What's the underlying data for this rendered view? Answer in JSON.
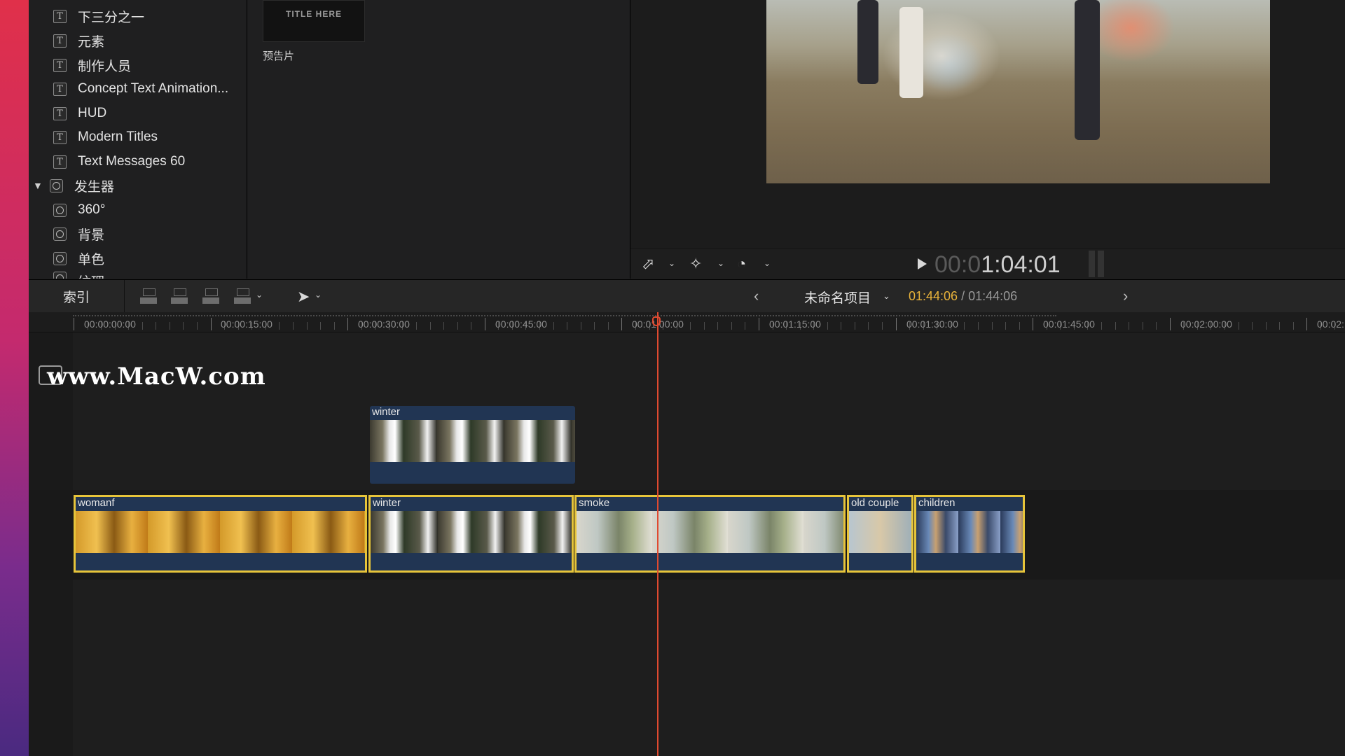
{
  "sidebar": {
    "items": [
      {
        "label": "下三分之一",
        "icon": "title-icon"
      },
      {
        "label": "元素",
        "icon": "title-icon"
      },
      {
        "label": "制作人员",
        "icon": "title-icon"
      },
      {
        "label": "Concept Text Animation...",
        "icon": "title-icon"
      },
      {
        "label": "HUD",
        "icon": "title-icon"
      },
      {
        "label": "Modern Titles",
        "icon": "title-icon"
      },
      {
        "label": "Text Messages 60",
        "icon": "title-icon"
      }
    ],
    "generators_label": "发生器",
    "generator_items": [
      {
        "label": "360°",
        "icon": "generator-icon"
      },
      {
        "label": "背景",
        "icon": "generator-icon"
      },
      {
        "label": "单色",
        "icon": "generator-icon"
      },
      {
        "label": "纹理",
        "icon": "generator-icon"
      }
    ]
  },
  "browser": {
    "thumbnail_text": "TITLE HERE",
    "thumbnail_label": "预告片"
  },
  "viewer": {
    "timecode_dim": "00:0",
    "timecode_main": "1:04:01"
  },
  "toolbar": {
    "index_label": "索引",
    "project_name": "未命名项目",
    "current_duration": "01:44:06",
    "separator": "/",
    "total_duration": "01:44:06",
    "prev_arrow": "‹",
    "next_arrow": "›"
  },
  "ruler": {
    "labels": [
      "00:00:00:00",
      "00:00:15:00",
      "00:00:30:00",
      "00:00:45:00",
      "00:01:00:00",
      "00:01:15:00",
      "00:01:30:00",
      "00:01:45:00",
      "00:02:00:00",
      "00:02:"
    ]
  },
  "watermark": "www.MacW.com",
  "clips": {
    "connected": {
      "name": "winter"
    },
    "primary": [
      {
        "name": "womanf"
      },
      {
        "name": "winter"
      },
      {
        "name": "smoke"
      },
      {
        "name": "old couple"
      },
      {
        "name": "children"
      }
    ]
  },
  "colors": {
    "clip_selection": "#e6c43a",
    "playhead": "#e04a30",
    "duration_accent": "#e8b23a",
    "clip_fill": "#213553"
  }
}
